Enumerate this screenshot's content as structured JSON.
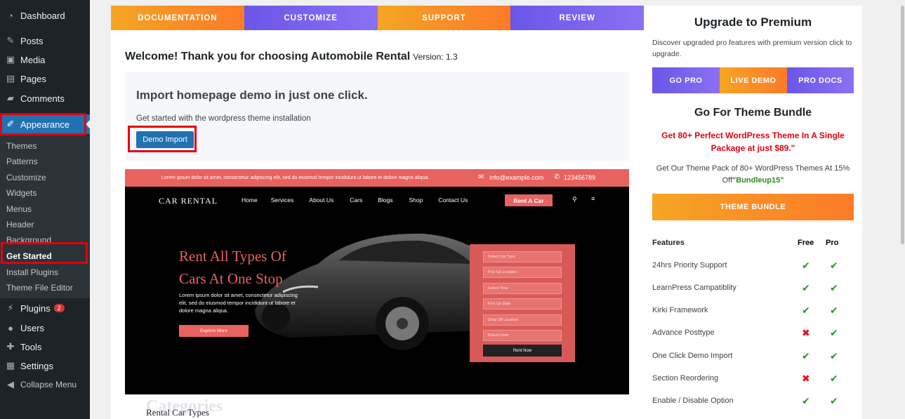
{
  "sidebar": {
    "dashboard": "Dashboard",
    "posts": "Posts",
    "media": "Media",
    "pages": "Pages",
    "comments": "Comments",
    "appearance": "Appearance",
    "submenu": [
      "Themes",
      "Patterns",
      "Customize",
      "Widgets",
      "Menus",
      "Header",
      "Background",
      "Get Started",
      "Install Plugins",
      "Theme File Editor"
    ],
    "plugins": "Plugins",
    "plugins_badge": "2",
    "users": "Users",
    "tools": "Tools",
    "settings": "Settings",
    "collapse": "Collapse Menu"
  },
  "tabs": [
    "DOCUMENTATION",
    "CUSTOMIZE",
    "SUPPORT",
    "REVIEW"
  ],
  "welcome": {
    "title": "Welcome! Thank you for choosing Automobile Rental",
    "version": "Version: 1.3"
  },
  "import": {
    "heading": "Import homepage demo in just one click.",
    "text": "Get started with the wordpress theme installation",
    "button": "Demo Import"
  },
  "preview": {
    "topbar_text": "Lorem ipsum dolor sit amet, consectetur adipiscing elit, sed do eiusmod tempor incididunt ut labore et dolore magna aliqua.",
    "email": "info@example.com",
    "phone": "123456789",
    "logo": "CAR RENTAL",
    "nav": [
      "Home",
      "Services",
      "About Us",
      "Cars",
      "Blogs",
      "Shop",
      "Contact Us"
    ],
    "cta": "Rent A Car",
    "hero_line1": "Rent All Types Of",
    "hero_line2": "Cars At One Stop",
    "hero_text": "Lorem ipsum dolor sit amet, consectetur adipiscing elit, sed do eiusmod tempor incididunt ut labore et dolore magna aliqua.",
    "explore": "Explore More",
    "form_fields": [
      "Select Car Type",
      "Pick Up Location",
      "Select Time",
      "Pick Up Date",
      "Drop Off Location",
      "Return Date"
    ],
    "rent_now": "Rent Now",
    "categories_bg": "Categories",
    "categories_title": "Rental Car Types"
  },
  "premium": {
    "title": "Upgrade to Premium",
    "desc": "Discover upgraded pro features with premium version click to upgrade.",
    "buttons": [
      "GO PRO",
      "LIVE DEMO",
      "PRO DOCS"
    ],
    "bundle_title": "Go For Theme Bundle",
    "bundle_red": "Get 80+ Perfect WordPress Theme In A Single Package at just $89.\"",
    "bundle_desc": "Get Our Theme Pack of 80+ WordPress Themes At 15% Off",
    "coupon": "\"Bundleup15\"",
    "bundle_button": "THEME BUNDLE"
  },
  "features": {
    "head": "Features",
    "free": "Free",
    "pro": "Pro",
    "rows": [
      {
        "label": "24hrs Priority Support",
        "free": true,
        "pro": true
      },
      {
        "label": "LearnPress Campatiblity",
        "free": true,
        "pro": true
      },
      {
        "label": "Kirki Framework",
        "free": true,
        "pro": true
      },
      {
        "label": "Advance Posttype",
        "free": false,
        "pro": true
      },
      {
        "label": "One Click Demo Import",
        "free": true,
        "pro": true
      },
      {
        "label": "Section Reordering",
        "free": false,
        "pro": true
      },
      {
        "label": "Enable / Disable Option",
        "free": true,
        "pro": true
      }
    ]
  },
  "colors": {
    "orange": "#f5a524",
    "purple": "#6a56e8",
    "wp_blue": "#2271b1",
    "coral": "#e8625f"
  }
}
